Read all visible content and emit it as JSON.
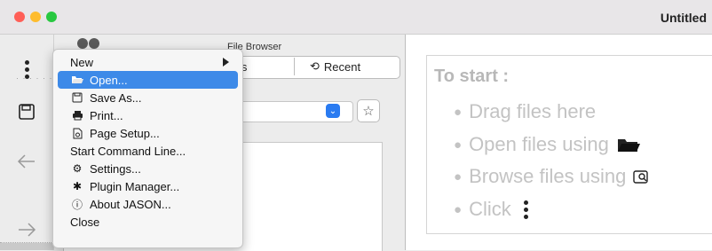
{
  "window": {
    "title": "Untitled"
  },
  "file_browser": {
    "title": "File Browser",
    "tabs": [
      {
        "label": "Favorites",
        "visible_label": "tes"
      },
      {
        "label": "Recent"
      }
    ]
  },
  "menu": {
    "items": [
      {
        "label": "New",
        "icon": "none",
        "submenu": true
      },
      {
        "label": "Open...",
        "icon": "folder-icon",
        "highlighted": true
      },
      {
        "label": "Save As...",
        "icon": "disk-icon"
      },
      {
        "label": "Print...",
        "icon": "printer-icon"
      },
      {
        "label": "Page Setup...",
        "icon": "page-setup-icon"
      },
      {
        "label": "Start Command Line...",
        "icon": "none"
      },
      {
        "label": "Settings...",
        "icon": "gear-icon"
      },
      {
        "label": "Plugin Manager...",
        "icon": "puzzle-icon"
      },
      {
        "label": "About JASON...",
        "icon": "info-icon"
      },
      {
        "label": "Close",
        "icon": "none"
      }
    ]
  },
  "start": {
    "title": "To start :",
    "hints": [
      "Drag files here",
      "Open files using",
      "Browse files using",
      "Click"
    ]
  },
  "colors": {
    "highlight": "#3d8ae8",
    "accent_blue": "#2a7bf1",
    "hint_text": "#c3c3c3"
  }
}
